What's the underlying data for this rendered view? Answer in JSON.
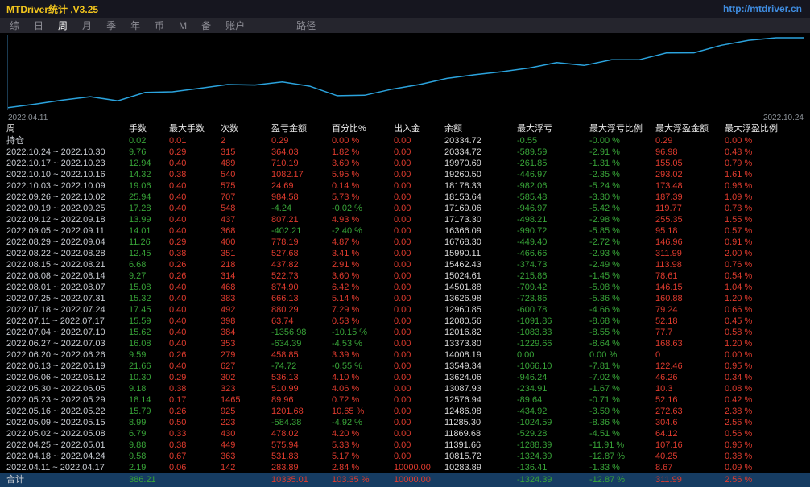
{
  "header": {
    "title": "MTDriver统计 ,V3.25",
    "url": "http://mtdriver.cn"
  },
  "menu": {
    "items": [
      {
        "key": "summary",
        "label": "综"
      },
      {
        "key": "daily",
        "label": "日"
      },
      {
        "key": "weekly",
        "label": "周"
      },
      {
        "key": "monthly",
        "label": "月"
      },
      {
        "key": "quarterly",
        "label": "季"
      },
      {
        "key": "yearly",
        "label": "年"
      },
      {
        "key": "currency",
        "label": "币"
      },
      {
        "key": "m",
        "label": "M"
      },
      {
        "key": "backup",
        "label": "备"
      },
      {
        "key": "account",
        "label": "账户"
      },
      {
        "key": "path",
        "label": "路径"
      }
    ],
    "active_key": "weekly"
  },
  "colors": {
    "title": "#f2c51d",
    "link": "#3f8cdf",
    "gain": "#df3b2e",
    "loss": "#38a438",
    "chart_line": "#2ba3dd",
    "total_row_bg": "#163c62"
  },
  "chart": {
    "start_label": "2022.04.11",
    "end_label": "2022.10.24"
  },
  "chart_data": {
    "type": "line",
    "title": "",
    "xlabel": "",
    "ylabel": "余额",
    "x_labels": [
      "2022.04.11",
      "2022.10.24"
    ],
    "ylim": [
      10150,
      20450
    ],
    "grid": false,
    "legend": false,
    "line_color": "#2ba3dd",
    "series": [
      {
        "name": "余额",
        "values": [
          10283.89,
          10815.72,
          11391.66,
          11869.68,
          11285.3,
          12486.98,
          12576.94,
          13087.93,
          13624.06,
          13549.34,
          14008.19,
          13373.8,
          12016.82,
          12080.56,
          12960.85,
          13626.98,
          14501.88,
          15024.61,
          15462.43,
          15990.11,
          16768.3,
          16366.09,
          17173.3,
          17169.06,
          18153.64,
          18178.33,
          19260.5,
          19970.69,
          20334.72,
          20334.72
        ]
      }
    ]
  },
  "table": {
    "columns": [
      "周",
      "手数",
      "最大手数",
      "次数",
      "盈亏金额",
      "百分比%",
      "出入金",
      "余额",
      "最大浮亏",
      "最大浮亏比例",
      "最大浮盈金额",
      "最大浮盈比例"
    ],
    "column_keys": [
      "week",
      "lots",
      "max-lots",
      "trades",
      "pnl",
      "percent",
      "net-deposit",
      "balance",
      "max-float-loss",
      "max-float-loss-pct",
      "max-float-profit",
      "max-float-profit-pct"
    ],
    "column_styles": [
      "plain",
      "green",
      "red",
      "red",
      "signed",
      "signed",
      "red",
      "white",
      "green",
      "green",
      "red",
      "red"
    ],
    "rows": [
      [
        "持仓",
        "0.02",
        "0.01",
        "2",
        "0.29",
        "0.00 %",
        "0.00",
        "20334.72",
        "-0.55",
        "-0.00 %",
        "0.29",
        "0.00 %"
      ],
      [
        "2022.10.24 ~ 2022.10.30",
        "9.76",
        "0.29",
        "315",
        "364.03",
        "1.82 %",
        "0.00",
        "20334.72",
        "-589.59",
        "-2.91 %",
        "96.98",
        "0.48 %"
      ],
      [
        "2022.10.17 ~ 2022.10.23",
        "12.94",
        "0.40",
        "489",
        "710.19",
        "3.69 %",
        "0.00",
        "19970.69",
        "-261.85",
        "-1.31 %",
        "155.05",
        "0.79 %"
      ],
      [
        "2022.10.10 ~ 2022.10.16",
        "14.32",
        "0.38",
        "540",
        "1082.17",
        "5.95 %",
        "0.00",
        "19260.50",
        "-446.97",
        "-2.35 %",
        "293.02",
        "1.61 %"
      ],
      [
        "2022.10.03 ~ 2022.10.09",
        "19.06",
        "0.40",
        "575",
        "24.69",
        "0.14 %",
        "0.00",
        "18178.33",
        "-982.06",
        "-5.24 %",
        "173.48",
        "0.96 %"
      ],
      [
        "2022.09.26 ~ 2022.10.02",
        "25.94",
        "0.40",
        "707",
        "984.58",
        "5.73 %",
        "0.00",
        "18153.64",
        "-585.48",
        "-3.30 %",
        "187.39",
        "1.09 %"
      ],
      [
        "2022.09.19 ~ 2022.09.25",
        "17.28",
        "0.40",
        "548",
        "-4.24",
        "-0.02 %",
        "0.00",
        "17169.06",
        "-946.97",
        "-5.42 %",
        "119.77",
        "0.73 %"
      ],
      [
        "2022.09.12 ~ 2022.09.18",
        "13.99",
        "0.40",
        "437",
        "807.21",
        "4.93 %",
        "0.00",
        "17173.30",
        "-498.21",
        "-2.98 %",
        "255.35",
        "1.55 %"
      ],
      [
        "2022.09.05 ~ 2022.09.11",
        "14.01",
        "0.40",
        "368",
        "-402.21",
        "-2.40 %",
        "0.00",
        "16366.09",
        "-990.72",
        "-5.85 %",
        "95.18",
        "0.57 %"
      ],
      [
        "2022.08.29 ~ 2022.09.04",
        "11.26",
        "0.29",
        "400",
        "778.19",
        "4.87 %",
        "0.00",
        "16768.30",
        "-449.40",
        "-2.72 %",
        "146.96",
        "0.91 %"
      ],
      [
        "2022.08.22 ~ 2022.08.28",
        "12.45",
        "0.38",
        "351",
        "527.68",
        "3.41 %",
        "0.00",
        "15990.11",
        "-466.66",
        "-2.93 %",
        "311.99",
        "2.00 %"
      ],
      [
        "2022.08.15 ~ 2022.08.21",
        "6.68",
        "0.26",
        "218",
        "437.82",
        "2.91 %",
        "0.00",
        "15462.43",
        "-374.73",
        "-2.49 %",
        "113.98",
        "0.76 %"
      ],
      [
        "2022.08.08 ~ 2022.08.14",
        "9.27",
        "0.26",
        "314",
        "522.73",
        "3.60 %",
        "0.00",
        "15024.61",
        "-215.86",
        "-1.45 %",
        "78.61",
        "0.54 %"
      ],
      [
        "2022.08.01 ~ 2022.08.07",
        "15.08",
        "0.40",
        "468",
        "874.90",
        "6.42 %",
        "0.00",
        "14501.88",
        "-709.42",
        "-5.08 %",
        "146.15",
        "1.04 %"
      ],
      [
        "2022.07.25 ~ 2022.07.31",
        "15.32",
        "0.40",
        "383",
        "666.13",
        "5.14 %",
        "0.00",
        "13626.98",
        "-723.86",
        "-5.36 %",
        "160.88",
        "1.20 %"
      ],
      [
        "2022.07.18 ~ 2022.07.24",
        "17.45",
        "0.40",
        "492",
        "880.29",
        "7.29 %",
        "0.00",
        "12960.85",
        "-600.78",
        "-4.66 %",
        "79.24",
        "0.66 %"
      ],
      [
        "2022.07.11 ~ 2022.07.17",
        "15.59",
        "0.40",
        "398",
        "63.74",
        "0.53 %",
        "0.00",
        "12080.56",
        "-1091.86",
        "-8.68 %",
        "52.18",
        "0.45 %"
      ],
      [
        "2022.07.04 ~ 2022.07.10",
        "15.62",
        "0.40",
        "384",
        "-1356.98",
        "-10.15 %",
        "0.00",
        "12016.82",
        "-1083.83",
        "-8.55 %",
        "77.7",
        "0.58 %"
      ],
      [
        "2022.06.27 ~ 2022.07.03",
        "16.08",
        "0.40",
        "353",
        "-634.39",
        "-4.53 %",
        "0.00",
        "13373.80",
        "-1229.66",
        "-8.64 %",
        "168.63",
        "1.20 %"
      ],
      [
        "2022.06.20 ~ 2022.06.26",
        "9.59",
        "0.26",
        "279",
        "458.85",
        "3.39 %",
        "0.00",
        "14008.19",
        "0.00",
        "0.00 %",
        "0",
        "0.00 %"
      ],
      [
        "2022.06.13 ~ 2022.06.19",
        "21.66",
        "0.40",
        "627",
        "-74.72",
        "-0.55 %",
        "0.00",
        "13549.34",
        "-1066.10",
        "-7.81 %",
        "122.46",
        "0.95 %"
      ],
      [
        "2022.06.06 ~ 2022.06.12",
        "10.30",
        "0.29",
        "302",
        "536.13",
        "4.10 %",
        "0.00",
        "13624.06",
        "-946.24",
        "-7.02 %",
        "46.26",
        "0.34 %"
      ],
      [
        "2022.05.30 ~ 2022.06.05",
        "9.18",
        "0.38",
        "323",
        "510.99",
        "4.06 %",
        "0.00",
        "13087.93",
        "-234.91",
        "-1.67 %",
        "10.3",
        "0.08 %"
      ],
      [
        "2022.05.23 ~ 2022.05.29",
        "18.14",
        "0.17",
        "1465",
        "89.96",
        "0.72 %",
        "0.00",
        "12576.94",
        "-89.64",
        "-0.71 %",
        "52.16",
        "0.42 %"
      ],
      [
        "2022.05.16 ~ 2022.05.22",
        "15.79",
        "0.26",
        "925",
        "1201.68",
        "10.65 %",
        "0.00",
        "12486.98",
        "-434.92",
        "-3.59 %",
        "272.63",
        "2.38 %"
      ],
      [
        "2022.05.09 ~ 2022.05.15",
        "8.99",
        "0.50",
        "223",
        "-584.38",
        "-4.92 %",
        "0.00",
        "11285.30",
        "-1024.59",
        "-8.36 %",
        "304.6",
        "2.56 %"
      ],
      [
        "2022.05.02 ~ 2022.05.08",
        "6.79",
        "0.33",
        "430",
        "478.02",
        "4.20 %",
        "0.00",
        "11869.68",
        "-529.28",
        "-4.51 %",
        "64.12",
        "0.56 %"
      ],
      [
        "2022.04.25 ~ 2022.05.01",
        "9.88",
        "0.38",
        "449",
        "575.94",
        "5.33 %",
        "0.00",
        "11391.66",
        "-1288.39",
        "-11.91 %",
        "107.16",
        "0.96 %"
      ],
      [
        "2022.04.18 ~ 2022.04.24",
        "9.58",
        "0.67",
        "363",
        "531.83",
        "5.17 %",
        "0.00",
        "10815.72",
        "-1324.39",
        "-12.87 %",
        "40.25",
        "0.38 %"
      ],
      [
        "2022.04.11 ~ 2022.04.17",
        "2.19",
        "0.06",
        "142",
        "283.89",
        "2.84 %",
        "10000.00",
        "10283.89",
        "-136.41",
        "-1.33 %",
        "8.67",
        "0.09 %"
      ]
    ],
    "footer": [
      "合计",
      "386.21",
      "",
      "",
      "10335.01",
      "103.35 %",
      "10000.00",
      "",
      "-1324.39",
      "-12.87 %",
      "311.99",
      "2.56 %"
    ]
  }
}
